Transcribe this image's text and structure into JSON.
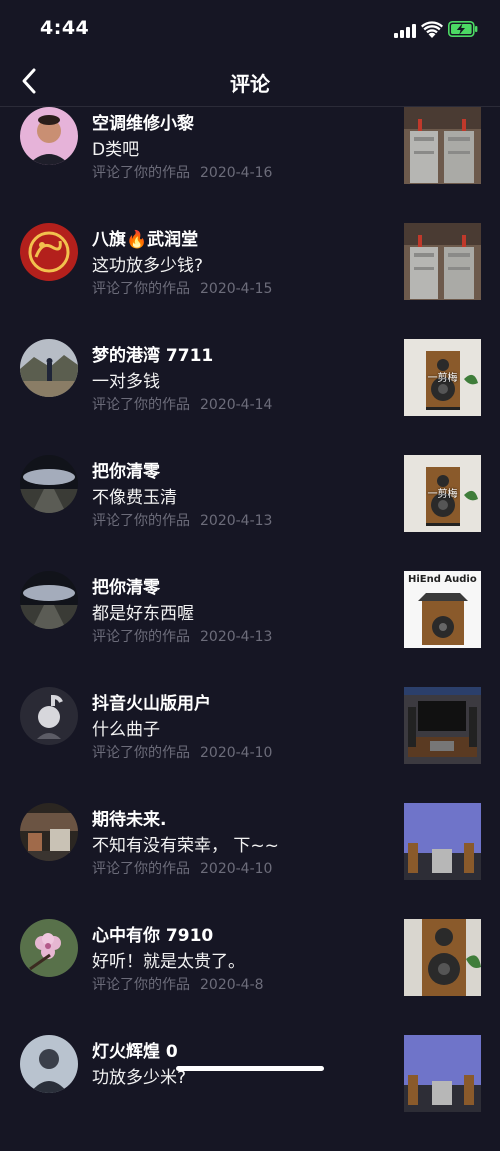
{
  "status_bar": {
    "time": "4:44"
  },
  "header": {
    "title": "评论"
  },
  "notifications": [
    {
      "user": "空调维修小黎",
      "comment": "D类吧",
      "action": "评论了你的作品",
      "date": "2020-4-16",
      "avatar_icon": "person-avatar",
      "thumb_icon": "amplifier-photo"
    },
    {
      "user": "八旗🔥武润堂",
      "comment": "这功放多少钱?",
      "action": "评论了你的作品",
      "date": "2020-4-15",
      "avatar_icon": "dragon-emblem-avatar",
      "thumb_icon": "amplifier-photo"
    },
    {
      "user": "梦的港湾 7711",
      "comment": "一对多钱",
      "action": "评论了你的作品",
      "date": "2020-4-14",
      "avatar_icon": "landscape-avatar",
      "thumb_icon": "speaker-photo",
      "thumb_caption": "一剪梅"
    },
    {
      "user": "把你清零",
      "comment": "不像费玉清",
      "action": "评论了你的作品",
      "date": "2020-4-13",
      "avatar_icon": "night-road-avatar",
      "thumb_icon": "speaker-photo",
      "thumb_caption": "一剪梅"
    },
    {
      "user": "把你清零",
      "comment": "都是好东西喔",
      "action": "评论了你的作品",
      "date": "2020-4-13",
      "avatar_icon": "night-road-avatar",
      "thumb_icon": "hiend-audio-cover",
      "thumb_caption": "HiEnd Audio"
    },
    {
      "user": "抖音火山版用户",
      "comment": "什么曲子",
      "action": "评论了你的作品",
      "date": "2020-4-10",
      "avatar_icon": "default-user-avatar",
      "thumb_icon": "tv-cabinet-photo"
    },
    {
      "user": "期待未来.",
      "comment": "不知有没有荣幸， 下~~",
      "action": "评论了你的作品",
      "date": "2020-4-10",
      "avatar_icon": "street-avatar",
      "thumb_icon": "listening-room-photo"
    },
    {
      "user": "心中有你 7910",
      "comment": "好听！就是太贵了。",
      "action": "评论了你的作品",
      "date": "2020-4-8",
      "avatar_icon": "flower-avatar",
      "thumb_icon": "speaker-closeup-photo"
    },
    {
      "user": "灯火辉煌 0",
      "comment": "功放多少米?",
      "action": "",
      "date": "",
      "avatar_icon": "person-avatar",
      "thumb_icon": "listening-room-photo"
    }
  ]
}
